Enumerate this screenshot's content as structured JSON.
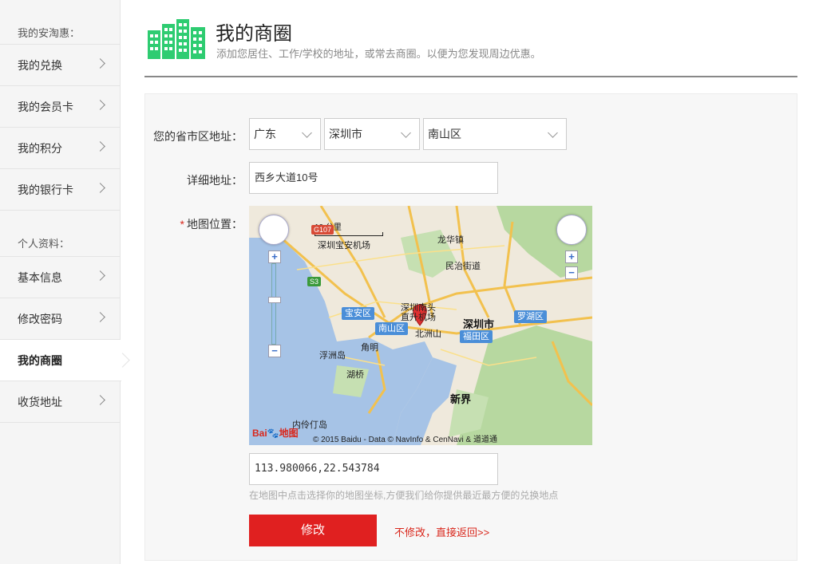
{
  "sidebar": {
    "section1_title": "我的安淘惠：",
    "section1_items": [
      "我的兑换",
      "我的会员卡",
      "我的积分",
      "我的银行卡"
    ],
    "section2_title": "个人资料：",
    "section2_items": [
      "基本信息",
      "修改密码",
      "我的商圈",
      "收货地址"
    ],
    "active_item": "我的商圈"
  },
  "header": {
    "title": "我的商圈",
    "subtitle": "添加您居住、工作/学校的地址，或常去商圈。以便为您发现周边优惠。",
    "logo_icon": "buildings-icon",
    "accent": "#2ecc71"
  },
  "form": {
    "region_label": "您的省市区地址：",
    "province": "广东",
    "city": "深圳市",
    "district": "南山区",
    "address_label": "详细地址：",
    "address_value": "西乡大道10号",
    "map_label": "地图位置：",
    "required_mark": "*",
    "coords_value": "113.980066,22.543784",
    "coords_hint": "在地图中点击选择你的地图坐标,方便我们给你提供最近最方便的兑换地点",
    "submit_label": "修改",
    "back_label": "不修改，直接返回>>"
  },
  "map": {
    "scale_text": "10 公里",
    "copyright": "© 2015 Baidu - Data © NavInfo & CenNavi & 道道通",
    "brand": "Bai",
    "brand2": "地图",
    "labels": {
      "airport": "深圳宝安机场",
      "longhua": "龙华镇",
      "minzhi": "民治街道",
      "shenzhen_south": "深圳南头",
      "zhiji": "直升机场",
      "beizhou": "北洲山",
      "shenzhen": "深圳市",
      "jiangming": "角明",
      "qiling": "浮洲岛",
      "huqiao": "湖桥",
      "xinjie": "新界",
      "neiling": "内伶仃岛",
      "g107": "G107",
      "s3": "S3"
    },
    "tags": {
      "baoan": "宝安区",
      "nanshan": "南山区",
      "futian": "福田区",
      "luohu": "罗湖区"
    },
    "zoom_in": "+",
    "zoom_out": "−"
  },
  "colors": {
    "primary_button": "#e02020",
    "link": "#d9271c",
    "marker": "#e03030",
    "sea": "#a6c3e6",
    "land": "#efe9dc",
    "green": "#b7d8a0"
  }
}
